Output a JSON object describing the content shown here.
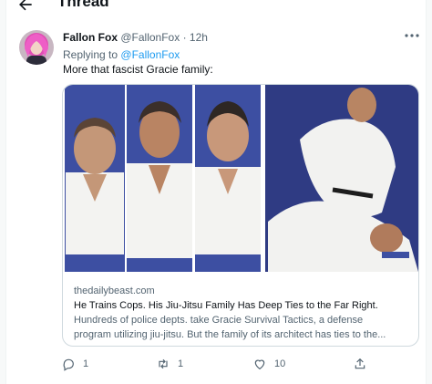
{
  "header": {
    "title": "Thread",
    "back_icon": "arrow-left-icon"
  },
  "tweet": {
    "author_name": "Fallon Fox",
    "author_handle": "@FallonFox",
    "separator": "·",
    "time": "12h",
    "replying_prefix": "Replying to",
    "replying_handle": "@FallonFox",
    "text": "More that fascist Gracie family:",
    "more_icon": "more-horizontal-icon"
  },
  "card": {
    "domain": "thedailybeast.com",
    "title": "He Trains Cops. His Jiu-Jitsu Family Has Deep Ties to the Far Right.",
    "description_line1": "Hundreds of police depts. take Gracie Survival Tactics, a defense",
    "description_line2": "program utilizing jiu-jitsu. But the family of its architect has ties to the..."
  },
  "actions": {
    "reply_count": "1",
    "retweet_count": "1",
    "like_count": "10"
  },
  "colors": {
    "accent": "#1d9bf0",
    "muted": "#536471",
    "border": "#cfd9de",
    "image_blue": "#3d4fa2"
  }
}
